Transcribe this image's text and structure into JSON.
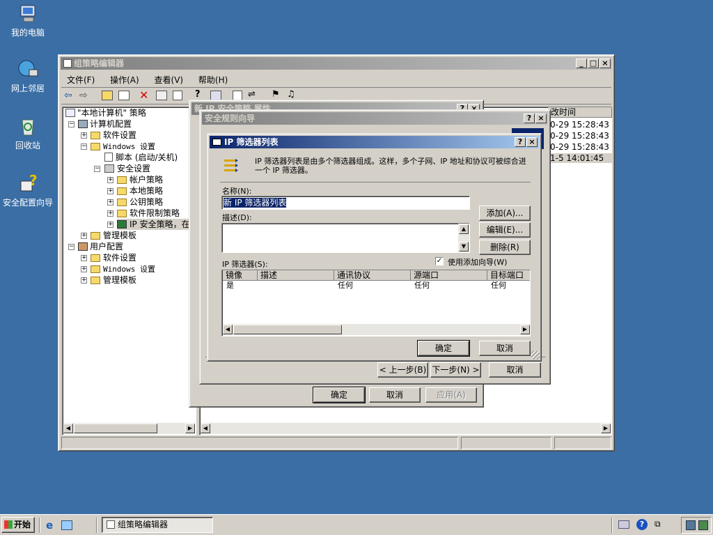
{
  "desktop": {
    "icons": [
      {
        "label": "我的电脑",
        "icon": "computer-icon"
      },
      {
        "label": "网上邻居",
        "icon": "network-icon"
      },
      {
        "label": "回收站",
        "icon": "recycle-bin-icon"
      },
      {
        "label": "安全配置向导",
        "icon": "security-wizard-icon"
      }
    ]
  },
  "gpedit": {
    "title": "组策略编辑器",
    "menu": [
      "文件(F)",
      "操作(A)",
      "查看(V)",
      "帮助(H)"
    ],
    "tree": [
      {
        "label": "\"本地计算机\" 策略"
      },
      {
        "label": "计算机配置"
      },
      {
        "label": "软件设置"
      },
      {
        "label": "Windows 设置"
      },
      {
        "label": "脚本 (启动/关机)"
      },
      {
        "label": "安全设置"
      },
      {
        "label": "帐户策略"
      },
      {
        "label": "本地策略"
      },
      {
        "label": "公钥策略"
      },
      {
        "label": "软件限制策略"
      },
      {
        "label": "IP 安全策略，在"
      },
      {
        "label": "管理模板"
      },
      {
        "label": "用户配置"
      },
      {
        "label": "软件设置"
      },
      {
        "label": "Windows 设置"
      },
      {
        "label": "管理模板"
      }
    ],
    "right_header": "改时间",
    "right_rows": [
      "0-29 15:28:43",
      "0-29 15:28:43",
      "0-29 15:28:43",
      "1-5 14:01:45"
    ]
  },
  "props_dialog": {
    "title": "新 IP 安全策略 属性",
    "ok": "确定",
    "cancel": "取消",
    "apply": "应用(A)"
  },
  "wizard": {
    "title": "安全规则向导",
    "back": "< 上一步(B)",
    "next": "下一步(N) >",
    "cancel": "取消"
  },
  "filter_dialog": {
    "title": "IP 筛选器列表",
    "description": "IP 筛选器列表是由多个筛选器组成。这样，多个子网、IP 地址和协议可被综合进一个 IP 筛选器。",
    "name_label": "名称(N):",
    "name_value": "新 IP 筛选器列表",
    "desc_label": "描述(D):",
    "desc_value": "",
    "add": "添加(A)...",
    "edit": "编辑(E)...",
    "remove": "删除(R)",
    "filters_label": "IP 筛选器(S):",
    "use_wizard": "使用添加向导(W)",
    "use_wizard_checked": true,
    "columns": [
      "镜像",
      "描述",
      "通讯协议",
      "源端口",
      "目标端口"
    ],
    "rows": [
      [
        "是",
        "",
        "任何",
        "任何",
        "任何"
      ]
    ],
    "ok": "确定",
    "cancel": "取消"
  },
  "taskbar": {
    "start": "开始",
    "task": "组策略编辑器"
  }
}
